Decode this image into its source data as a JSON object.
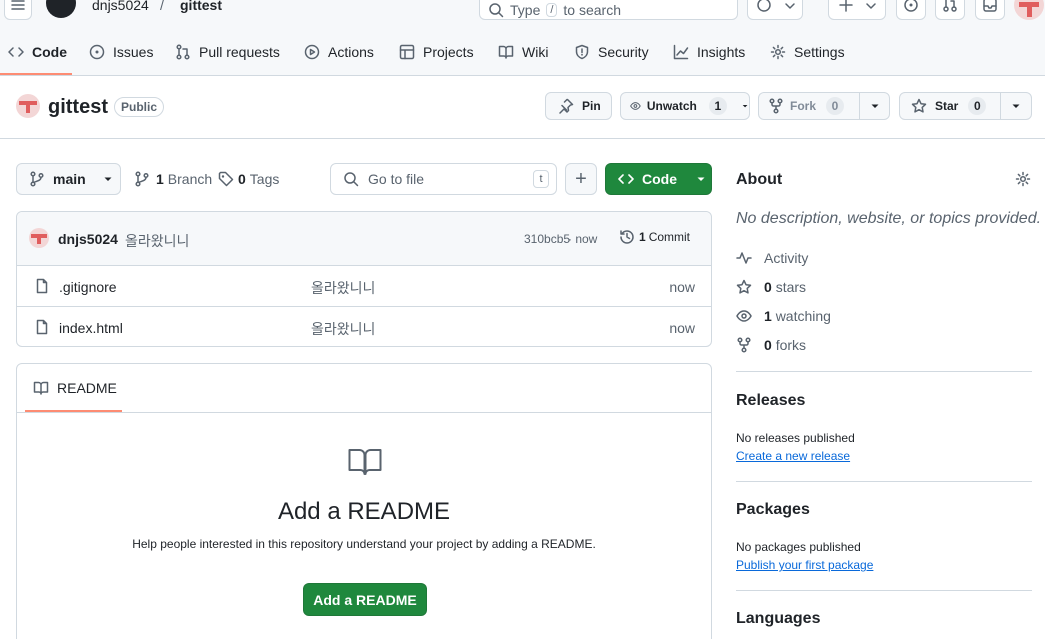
{
  "header": {
    "owner": "dnjs5024",
    "separator": "/",
    "repo": "gittest",
    "search_placeholder_pre": "Type",
    "search_key": "/",
    "search_placeholder_post": "to search"
  },
  "nav": {
    "tabs": [
      {
        "label": "Code",
        "icon": "code-icon"
      },
      {
        "label": "Issues",
        "icon": "issue-icon"
      },
      {
        "label": "Pull requests",
        "icon": "pull-request-icon"
      },
      {
        "label": "Actions",
        "icon": "play-icon"
      },
      {
        "label": "Projects",
        "icon": "table-icon"
      },
      {
        "label": "Wiki",
        "icon": "book-icon"
      },
      {
        "label": "Security",
        "icon": "shield-icon"
      },
      {
        "label": "Insights",
        "icon": "graph-icon"
      },
      {
        "label": "Settings",
        "icon": "gear-icon"
      }
    ],
    "active_index": 0
  },
  "repo": {
    "name": "gittest",
    "visibility": "Public",
    "pin_label": "Pin",
    "unwatch_label": "Unwatch",
    "watch_count": "1",
    "fork_label": "Fork",
    "fork_count": "0",
    "star_label": "Star",
    "star_count": "0"
  },
  "toolbar": {
    "branch": "main",
    "branches_count": "1",
    "branches_label": "Branch",
    "tags_count": "0",
    "tags_label": "Tags",
    "goto_placeholder": "Go to file",
    "goto_key": "t",
    "add_label": "+",
    "code_label": "Code"
  },
  "commit": {
    "author": "dnjs5024",
    "message": "올라왔니니",
    "hash": "310bcb5",
    "time": "· now",
    "count": "1",
    "count_label": "Commit"
  },
  "files": [
    {
      "name": ".gitignore",
      "message": "올라왔니니",
      "time": "now"
    },
    {
      "name": "index.html",
      "message": "올라왔니니",
      "time": "now"
    }
  ],
  "readme": {
    "tab_label": "README",
    "heading": "Add a README",
    "description": "Help people interested in this repository understand your project by adding a README.",
    "button_label": "Add a README"
  },
  "about": {
    "heading": "About",
    "description": "No description, website, or topics provided.",
    "activity_label": "Activity",
    "stars_count": "0",
    "stars_label": "stars",
    "watching_count": "1",
    "watching_label": "watching",
    "forks_count": "0",
    "forks_label": "forks"
  },
  "releases": {
    "heading": "Releases",
    "empty_text": "No releases published",
    "create_link": "Create a new release"
  },
  "packages": {
    "heading": "Packages",
    "empty_text": "No packages published",
    "publish_link": "Publish your first package"
  },
  "languages": {
    "heading": "Languages"
  },
  "colors": {
    "accent_green": "#1f883d",
    "link_blue": "#0969da",
    "tab_underline": "#fd8c73",
    "avatar_red": "#e05d5d"
  }
}
